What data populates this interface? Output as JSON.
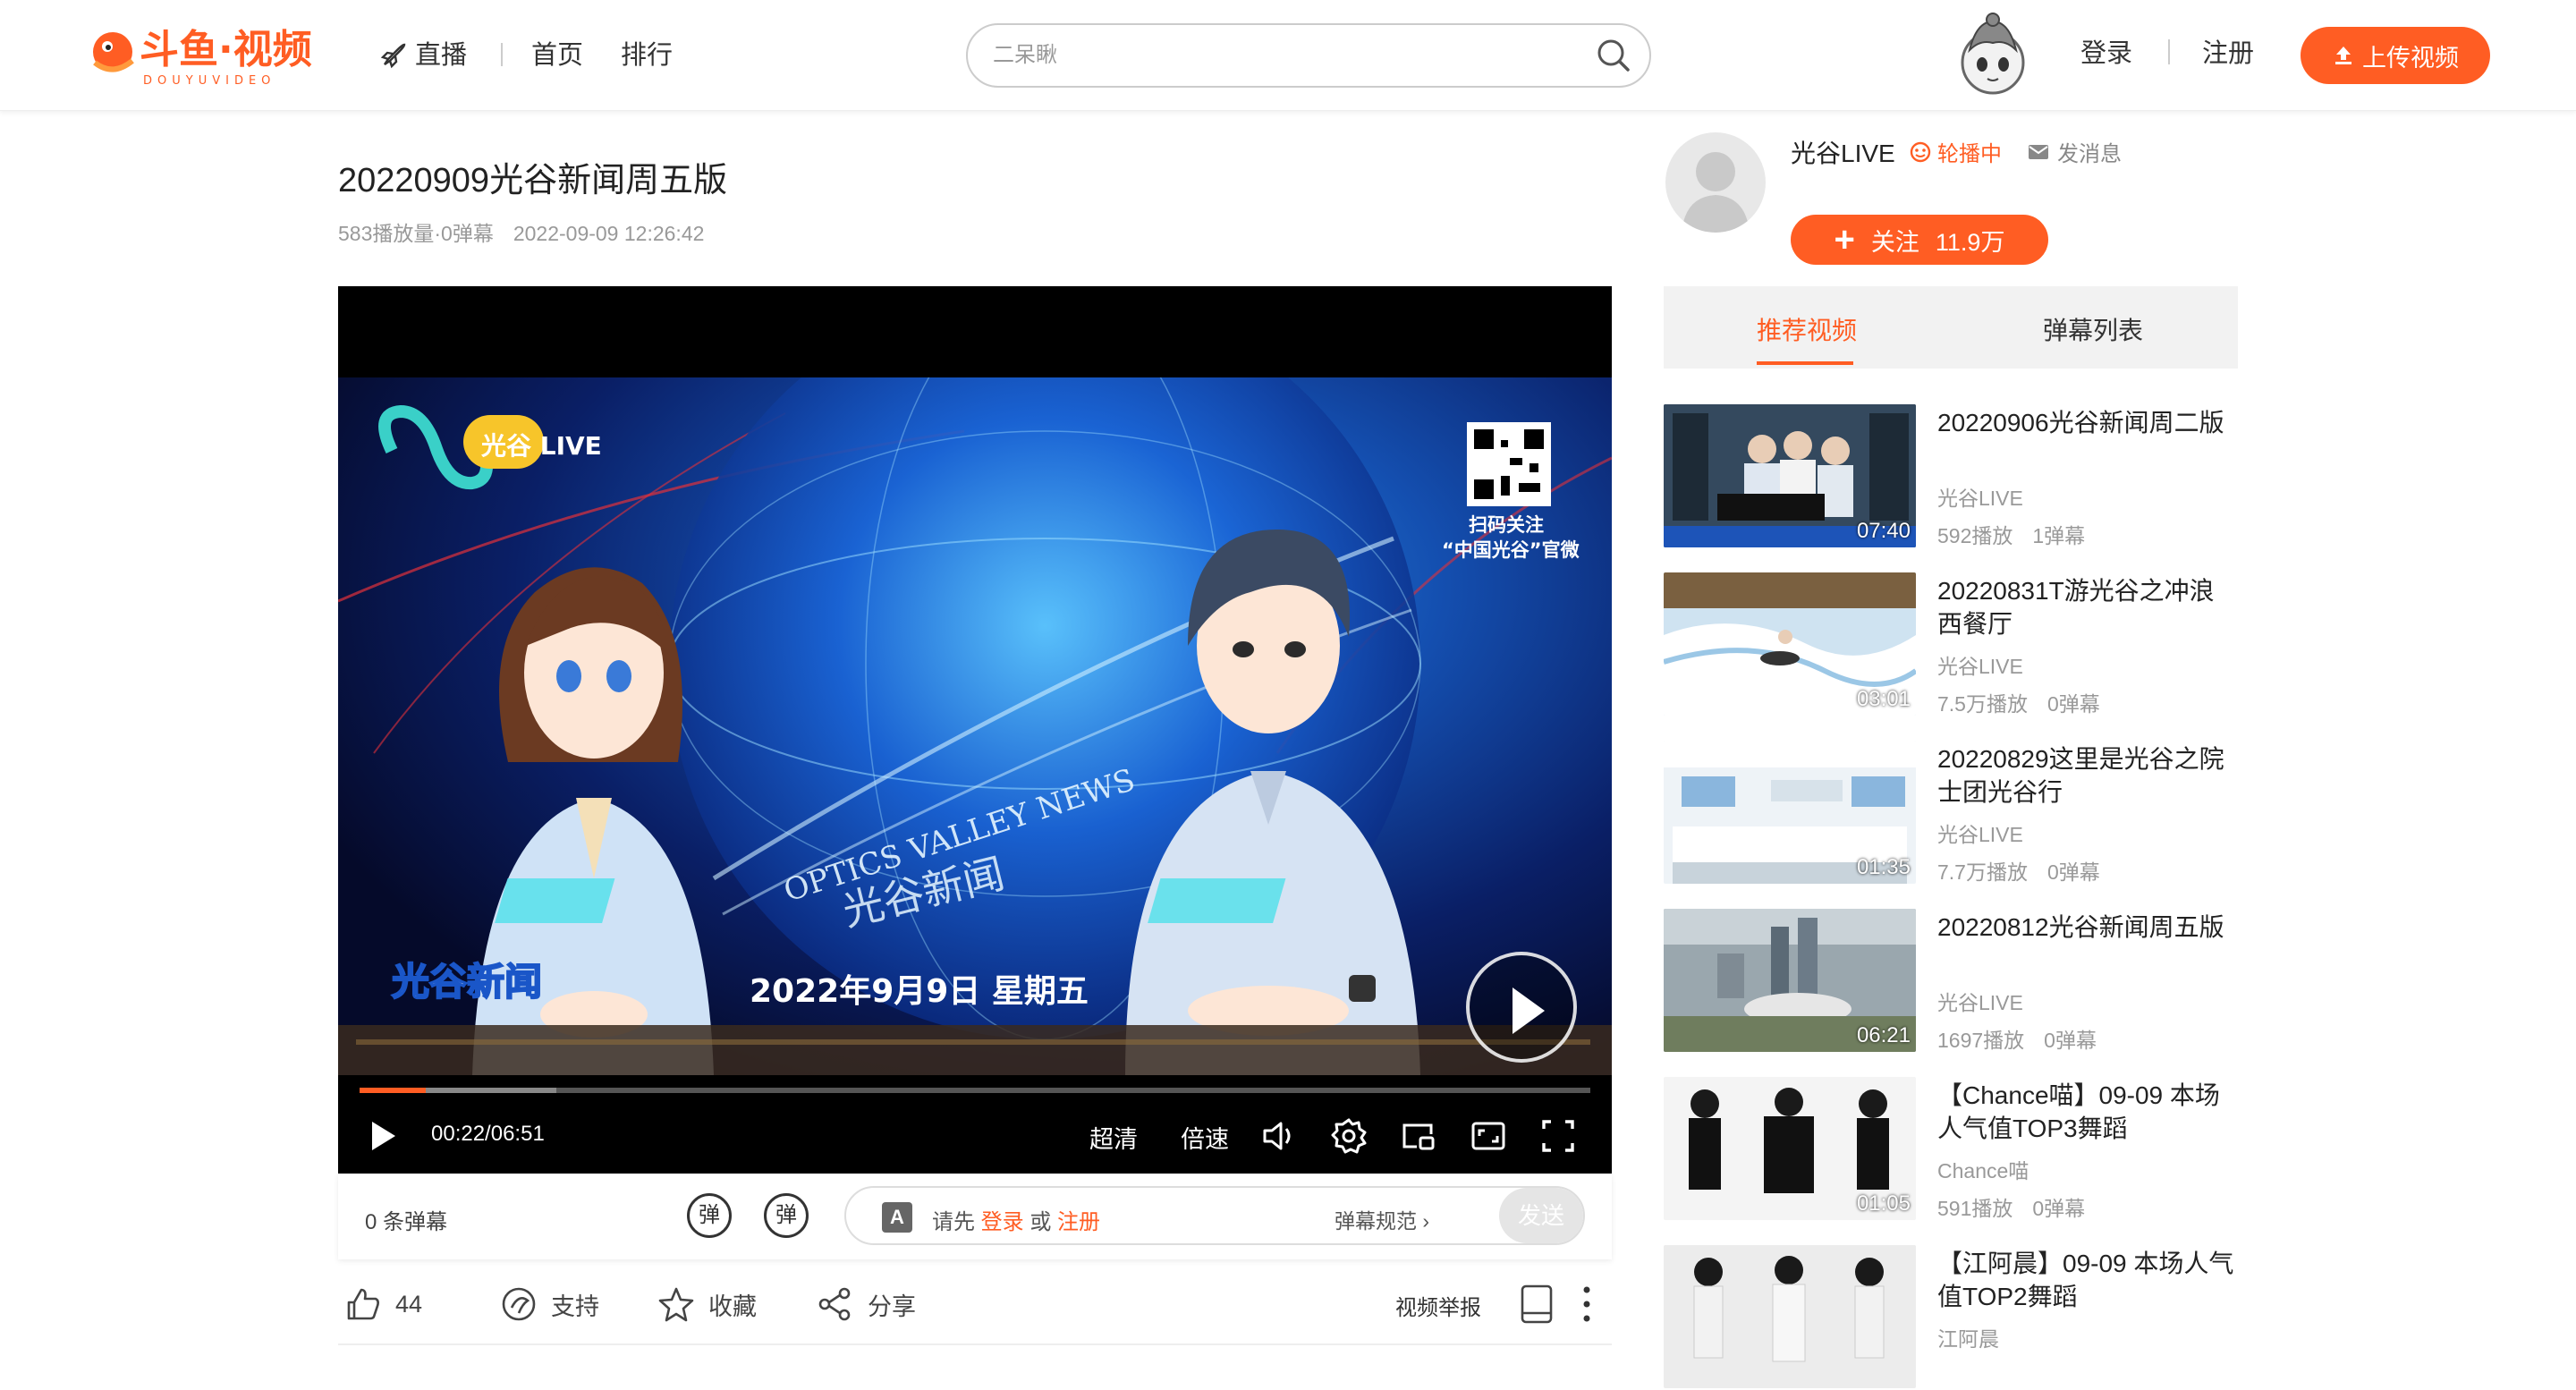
{
  "header": {
    "logo_text": "斗鱼·视频",
    "logo_sub": "DOUYUVIDEO",
    "nav": [
      {
        "label": "直播",
        "icon": "rocket-icon"
      },
      {
        "label": "首页"
      },
      {
        "label": "排行"
      }
    ],
    "search_placeholder": "二呆瞅",
    "login": "登录",
    "register": "注册",
    "upload": "上传视频"
  },
  "video": {
    "title": "20220909光谷新闻周五版",
    "views": "583播放量·0弹幕",
    "date": "2022-09-09 12:26:42",
    "overlay": {
      "channel_logo": "光谷 LIVE",
      "qr_caption_1": "扫码关注",
      "qr_caption_2": "“中国光谷”官微",
      "globe_text_en": "OPTICS VALLEY NEWS",
      "globe_text_cn": "光谷新闻",
      "date_text": "2022年9月9日 星期五",
      "show_logo": "光谷新闻"
    },
    "progress": {
      "played": 0.054,
      "buffered": 0.16
    },
    "time": "00:22/06:51",
    "controls": {
      "quality": "超清",
      "speed": "倍速"
    }
  },
  "danmaku": {
    "count": "0 条弹幕",
    "toggle_label": "弹",
    "settings_label": "弹",
    "prompt_prefix": "请先",
    "login": "登录",
    "or": "或",
    "register": "注册",
    "rules": "弹幕规范",
    "send": "发送"
  },
  "actions": {
    "like_count": "44",
    "support": "支持",
    "favorite": "收藏",
    "share": "分享",
    "report": "视频举报"
  },
  "uploader": {
    "name": "光谷LIVE",
    "live": "轮播中",
    "message": "发消息",
    "follow": "关注",
    "followers": "11.9万"
  },
  "tabs": [
    "推荐视频",
    "弹幕列表"
  ],
  "recommendations": [
    {
      "title": "20220906光谷新闻周二版",
      "author": "光谷LIVE",
      "plays": "592播放",
      "danmaku": "1弹幕",
      "duration": "07:40",
      "thumb": "office"
    },
    {
      "title": "20220831T游光谷之冲浪西餐厅",
      "author": "光谷LIVE",
      "plays": "7.5万播放",
      "danmaku": "0弹幕",
      "duration": "03:01",
      "thumb": "surf"
    },
    {
      "title": "20220829这里是光谷之院士团光谷行",
      "author": "光谷LIVE",
      "plays": "7.7万播放",
      "danmaku": "0弹幕",
      "duration": "01:35",
      "thumb": "hall"
    },
    {
      "title": "20220812光谷新闻周五版",
      "author": "光谷LIVE",
      "plays": "1697播放",
      "danmaku": "0弹幕",
      "duration": "06:21",
      "thumb": "city"
    },
    {
      "title": "【Chance喵】09-09 本场人气值TOP3舞蹈",
      "author": "Chance喵",
      "plays": "591播放",
      "danmaku": "0弹幕",
      "duration": "01:05",
      "thumb": "dance"
    },
    {
      "title": "【江阿晨】09-09 本场人气值TOP2舞蹈",
      "author": "江阿晨",
      "plays": "",
      "danmaku": "",
      "duration": "",
      "thumb": "dance2"
    }
  ],
  "colors": {
    "accent": "#ff5d23",
    "text": "#222222",
    "muted": "#999999"
  }
}
